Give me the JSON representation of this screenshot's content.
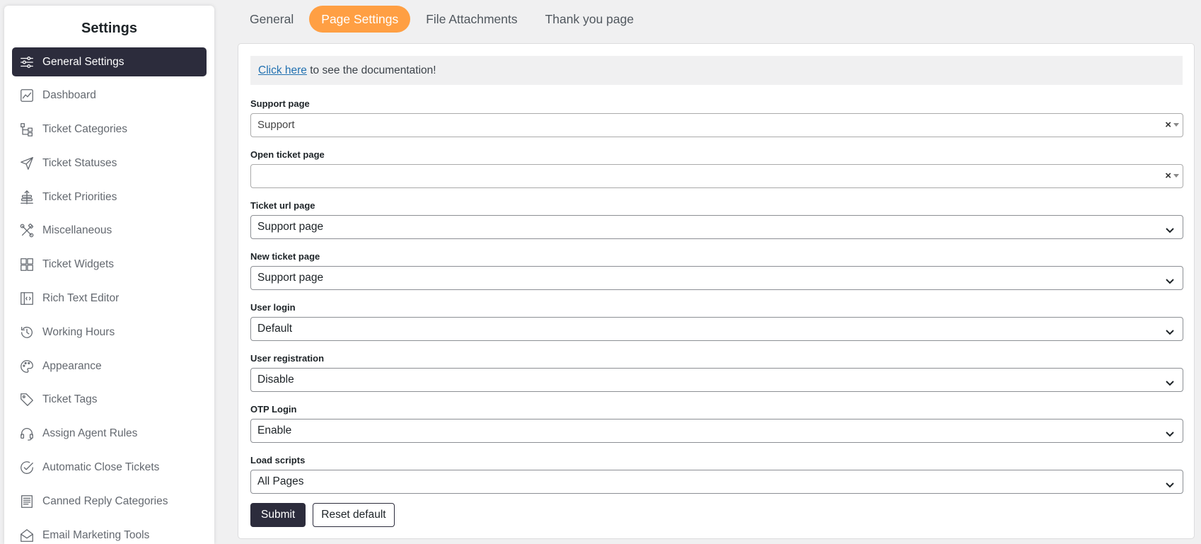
{
  "sidebar": {
    "title": "Settings",
    "items": [
      {
        "label": "General Settings",
        "icon": "sliders-icon",
        "active": true
      },
      {
        "label": "Dashboard",
        "icon": "chart-icon"
      },
      {
        "label": "Ticket Categories",
        "icon": "hierarchy-icon"
      },
      {
        "label": "Ticket Statuses",
        "icon": "send-icon"
      },
      {
        "label": "Ticket Priorities",
        "icon": "priority-icon"
      },
      {
        "label": "Miscellaneous",
        "icon": "tools-icon"
      },
      {
        "label": "Ticket Widgets",
        "icon": "widgets-icon"
      },
      {
        "label": "Rich Text Editor",
        "icon": "code-editor-icon"
      },
      {
        "label": "Working Hours",
        "icon": "clock-history-icon"
      },
      {
        "label": "Appearance",
        "icon": "palette-icon"
      },
      {
        "label": "Ticket Tags",
        "icon": "tag-icon"
      },
      {
        "label": "Assign Agent Rules",
        "icon": "headset-icon"
      },
      {
        "label": "Automatic Close Tickets",
        "icon": "check-circle-icon"
      },
      {
        "label": "Canned Reply Categories",
        "icon": "document-list-icon"
      },
      {
        "label": "Email Marketing Tools",
        "icon": "email-icon"
      }
    ]
  },
  "tabs": [
    {
      "label": "General"
    },
    {
      "label": "Page Settings",
      "active": true
    },
    {
      "label": "File Attachments"
    },
    {
      "label": "Thank you page"
    }
  ],
  "doc_note": {
    "link_text": "Click here",
    "rest_text": " to see the documentation!"
  },
  "fields": {
    "support_page": {
      "label": "Support page",
      "value": "Support",
      "clear": "×"
    },
    "open_ticket_page": {
      "label": "Open ticket page",
      "value": "",
      "clear": "×"
    },
    "ticket_url_page": {
      "label": "Ticket url page",
      "value": "Support page"
    },
    "new_ticket_page": {
      "label": "New ticket page",
      "value": "Support page"
    },
    "user_login": {
      "label": "User login",
      "value": "Default"
    },
    "user_registration": {
      "label": "User registration",
      "value": "Disable"
    },
    "otp_login": {
      "label": "OTP Login",
      "value": "Enable"
    },
    "load_scripts": {
      "label": "Load scripts",
      "value": "All Pages"
    }
  },
  "buttons": {
    "submit": "Submit",
    "reset": "Reset default"
  },
  "colors": {
    "active_nav": "#2c2c3c",
    "active_tab": "#ff9f43",
    "link": "#2271b1"
  }
}
